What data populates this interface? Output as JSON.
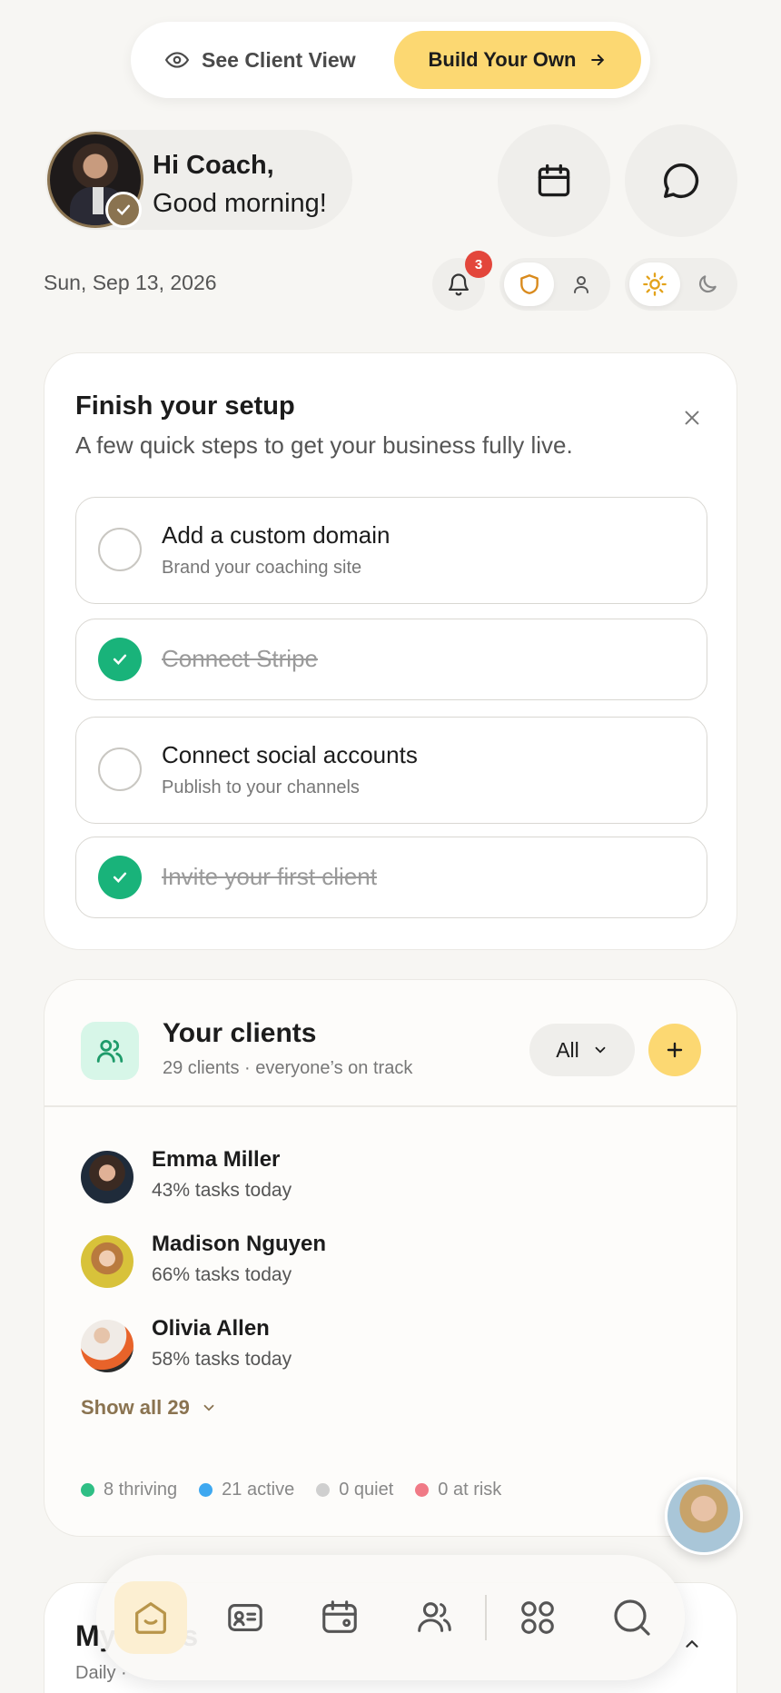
{
  "top_bar": {
    "see_client_view_label": "See Client View",
    "build_your_own_label": "Build Your Own"
  },
  "greeting": {
    "line1": "Hi Coach,",
    "line2": "Good morning!"
  },
  "date": "Sun, Sep 13, 2026",
  "notifications": {
    "count": "3"
  },
  "setup": {
    "title": "Finish your setup",
    "subtitle": "A few quick steps to get your business fully live.",
    "tasks": [
      {
        "title": "Add a custom domain",
        "subtitle": "Brand your coaching site",
        "done": false
      },
      {
        "title": "Connect Stripe",
        "done": true
      },
      {
        "title": "Connect social accounts",
        "subtitle": "Publish to your channels",
        "done": false
      },
      {
        "title": "Invite your first client",
        "done": true
      }
    ]
  },
  "clients": {
    "title": "Your clients",
    "subtitle": "29 clients · everyone’s on track",
    "filter_label": "All",
    "list": [
      {
        "name": "Emma Miller",
        "progress": "43% tasks today"
      },
      {
        "name": "Madison Nguyen",
        "progress": "66% tasks today"
      },
      {
        "name": "Olivia Allen",
        "progress": "58% tasks today"
      }
    ],
    "show_all_label": "Show all 29",
    "legend": [
      {
        "label": "8 thriving",
        "color": "#2fbf85"
      },
      {
        "label": "21 active",
        "color": "#3ea8f0"
      },
      {
        "label": "0 quiet",
        "color": "#cfcfcf"
      },
      {
        "label": "0 at risk",
        "color": "#f07a86"
      }
    ]
  },
  "tasks_card": {
    "title": "My tasks",
    "subtitle": "Daily ·"
  },
  "colors": {
    "accent_yellow": "#fcd872",
    "brand_gold": "#8a7350",
    "success_green": "#19b37a",
    "badge_red": "#e3463b"
  },
  "bottom_nav": {
    "items": [
      "home-icon",
      "contact-card-icon",
      "calendar-wallet-icon",
      "users-icon",
      "apps-grid-icon",
      "search-icon"
    ]
  }
}
